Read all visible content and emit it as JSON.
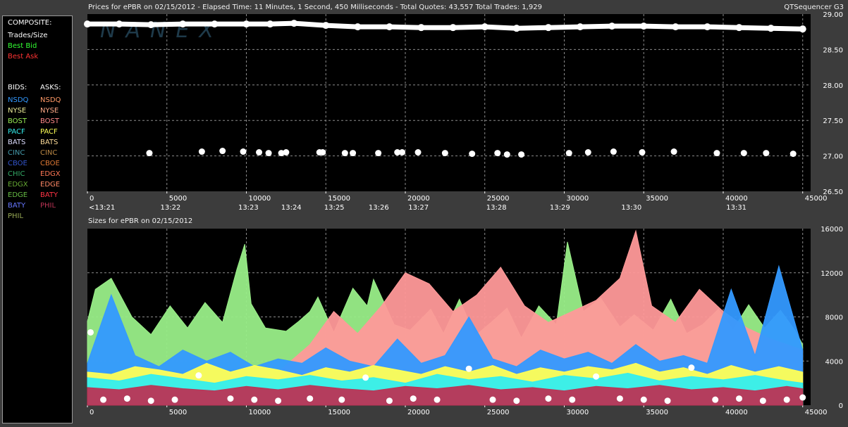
{
  "header": {
    "title": "Prices for  ePBR  on  02/15/2012  -  Elapsed Time: 11 Minutes, 1 Second, 450 Milliseconds  -  Total Quotes: 43,557  Total Trades: 1,929",
    "app_name": "QTSequencer G3"
  },
  "watermark": "NANEX",
  "legend": {
    "composite_label": "COMPOSITE:",
    "composite": [
      {
        "label": "Trades/Size",
        "color": "#ffffff"
      },
      {
        "label": "Best Bid",
        "color": "#33ff33"
      },
      {
        "label": "Best Ask",
        "color": "#ff3333"
      }
    ],
    "bids_label": "BIDS:",
    "asks_label": "ASKS:",
    "bids": [
      {
        "label": "NSDQ",
        "color": "#3399ff"
      },
      {
        "label": "NYSE",
        "color": "#eeee99"
      },
      {
        "label": "BOST",
        "color": "#99ee55"
      },
      {
        "label": "PACF",
        "color": "#33eeee"
      },
      {
        "label": "BATS",
        "color": "#ddddff"
      },
      {
        "label": "CINC",
        "color": "#4499aa"
      },
      {
        "label": "CBOE",
        "color": "#3355cc"
      },
      {
        "label": "CHIC",
        "color": "#33aa66"
      },
      {
        "label": "EDGX",
        "color": "#66aa33"
      },
      {
        "label": "EDGE",
        "color": "#66bb44"
      },
      {
        "label": "BATY",
        "color": "#6677ff"
      },
      {
        "label": "PHIL",
        "color": "#99aa55"
      }
    ],
    "asks": [
      {
        "label": "NSDQ",
        "color": "#ff9966"
      },
      {
        "label": "NYSE",
        "color": "#ffaa88"
      },
      {
        "label": "BOST",
        "color": "#ff8888"
      },
      {
        "label": "PACF",
        "color": "#ffff55"
      },
      {
        "label": "BATS",
        "color": "#ffdd99"
      },
      {
        "label": "CINC",
        "color": "#bb8844"
      },
      {
        "label": "CBOE",
        "color": "#dd7733"
      },
      {
        "label": "EDGX",
        "color": "#ff7755"
      },
      {
        "label": "EDGE",
        "color": "#ff8866"
      },
      {
        "label": "BATY",
        "color": "#ff3344"
      },
      {
        "label": "PHIL",
        "color": "#bb3355"
      }
    ]
  },
  "chart_data": [
    {
      "type": "scatter",
      "title": "Prices for  ePBR  on  02/15/2012",
      "x_ticks": [
        0,
        5000,
        10000,
        15000,
        20000,
        25000,
        30000,
        35000,
        40000,
        45000
      ],
      "time_ticks": [
        {
          "x": 0,
          "label": "<13:21"
        },
        {
          "x": 4500,
          "label": "13:22"
        },
        {
          "x": 9400,
          "label": "13:23"
        },
        {
          "x": 12100,
          "label": "13:24"
        },
        {
          "x": 14800,
          "label": "13:25"
        },
        {
          "x": 17600,
          "label": "13:26"
        },
        {
          "x": 20100,
          "label": "13:27"
        },
        {
          "x": 25000,
          "label": "13:28"
        },
        {
          "x": 29000,
          "label": "13:29"
        },
        {
          "x": 33500,
          "label": "13:30"
        },
        {
          "x": 40100,
          "label": "13:31"
        }
      ],
      "xlim": [
        0,
        45500
      ],
      "y_ticks": [
        29.0,
        28.5,
        28.0,
        27.5,
        27.0,
        26.5
      ],
      "ylim": [
        26.5,
        29.0
      ],
      "grid": true,
      "series": [
        {
          "name": "Trades/Size",
          "color": "#ffffff",
          "x": [
            3900,
            7200,
            8500,
            9800,
            10800,
            11400,
            12200,
            12500,
            14600,
            14800,
            16200,
            16700,
            18300,
            19500,
            19800,
            20800,
            22500,
            24200,
            25800,
            26400,
            27300,
            30300,
            31500,
            33100,
            34900,
            36900,
            39600,
            41300,
            42700,
            44400
          ],
          "y": [
            27.04,
            27.06,
            27.07,
            27.06,
            27.05,
            27.04,
            27.04,
            27.05,
            27.05,
            27.05,
            27.04,
            27.04,
            27.04,
            27.05,
            27.05,
            27.05,
            27.04,
            27.03,
            27.04,
            27.02,
            27.02,
            27.04,
            27.05,
            27.06,
            27.05,
            27.06,
            27.04,
            27.04,
            27.04,
            27.03
          ]
        },
        {
          "name": "Trades/Size",
          "color": "#ffffff",
          "x": [
            0,
            2000,
            4000,
            6000,
            8000,
            10000,
            11500,
            13000,
            15000,
            17000,
            19000,
            21000,
            23000,
            25000,
            27000,
            29000,
            31000,
            33000,
            35000,
            37000,
            39000,
            41000,
            43000,
            45000
          ],
          "y": [
            28.86,
            28.86,
            28.85,
            28.86,
            28.86,
            28.86,
            28.86,
            28.87,
            28.84,
            28.82,
            28.82,
            28.81,
            28.81,
            28.82,
            28.8,
            28.81,
            28.82,
            28.83,
            28.83,
            28.82,
            28.82,
            28.81,
            28.8,
            28.79
          ]
        }
      ]
    },
    {
      "type": "area",
      "title": "Sizes for  ePBR  on  02/15/2012",
      "x_ticks": [
        0,
        5000,
        10000,
        15000,
        20000,
        25000,
        30000,
        35000,
        40000,
        45000
      ],
      "xlim": [
        0,
        45500
      ],
      "y_ticks": [
        16000,
        12000,
        8000,
        4000,
        0
      ],
      "ylim": [
        0,
        16000
      ],
      "grid": true,
      "series": [
        {
          "name": "BOST",
          "color": "#99ee88",
          "x": [
            0,
            500,
            1500,
            2800,
            4000,
            5200,
            6300,
            7400,
            8500,
            9400,
            9900,
            10300,
            11200,
            12500,
            13300,
            14000,
            14500,
            15500,
            16700,
            17600,
            18000,
            19300,
            20300,
            21600,
            22400,
            23400,
            24400,
            25400,
            26400,
            27300,
            28400,
            29500,
            30200,
            31200,
            32300,
            33500,
            34400,
            35600,
            36700,
            37700,
            38700,
            39700,
            40600,
            41600,
            42600,
            43600,
            44500,
            45000
          ],
          "y": [
            7600,
            10500,
            11500,
            8000,
            6400,
            9000,
            7000,
            9300,
            7500,
            12300,
            14600,
            9200,
            7000,
            6700,
            7600,
            8500,
            9800,
            6600,
            10600,
            9000,
            11400,
            7300,
            6800,
            8700,
            6500,
            9600,
            6300,
            7500,
            8800,
            6100,
            9000,
            7300,
            14800,
            8500,
            9700,
            7100,
            8200,
            6800,
            9600,
            6500,
            7300,
            8700,
            6800,
            9100,
            7000,
            8600,
            6800,
            5500
          ]
        },
        {
          "name": "BOST",
          "color": "#ff9999",
          "x": [
            12000,
            14000,
            15500,
            17000,
            18500,
            20000,
            21500,
            23000,
            24500,
            26000,
            27500,
            29000,
            30500,
            32000,
            33500,
            34500,
            35500,
            37000,
            38500,
            40000,
            41500,
            43000,
            45000
          ],
          "y": [
            3000,
            5500,
            8500,
            6500,
            9000,
            12000,
            11000,
            8500,
            10000,
            12500,
            9000,
            7500,
            8500,
            9500,
            11500,
            15800,
            9000,
            7500,
            10500,
            8500,
            7000,
            6000,
            5000
          ]
        },
        {
          "name": "NSDQ",
          "color": "#3399ff",
          "x": [
            0,
            1500,
            3000,
            4500,
            6000,
            7500,
            9000,
            10500,
            12000,
            13500,
            15000,
            16500,
            18000,
            19500,
            21000,
            22500,
            24000,
            25500,
            27000,
            28500,
            30000,
            31500,
            33000,
            34500,
            36000,
            37500,
            39000,
            40500,
            42000,
            43500,
            45000
          ],
          "y": [
            3800,
            10000,
            4500,
            3500,
            5000,
            4000,
            4800,
            3500,
            4200,
            3800,
            5200,
            4000,
            3500,
            6000,
            3800,
            4500,
            8000,
            4200,
            3500,
            5000,
            4200,
            4800,
            3800,
            5500,
            4000,
            4500,
            3800,
            10500,
            4500,
            12600,
            5000
          ]
        },
        {
          "name": "PACF",
          "color": "#ffff55",
          "x": [
            0,
            1500,
            3000,
            4500,
            6000,
            7500,
            9000,
            10500,
            12000,
            13500,
            15000,
            16500,
            18000,
            19500,
            21000,
            22500,
            24000,
            25500,
            27000,
            28500,
            30000,
            31500,
            33000,
            34500,
            36000,
            37500,
            39000,
            40500,
            42000,
            43500,
            45000
          ],
          "y": [
            3000,
            2800,
            3500,
            3200,
            2800,
            3800,
            3000,
            3600,
            3200,
            2700,
            3400,
            3000,
            3600,
            3200,
            2800,
            3500,
            3000,
            3600,
            2800,
            3400,
            3000,
            3500,
            3200,
            3800,
            3000,
            3400,
            2800,
            3600,
            3000,
            3500,
            3000
          ]
        },
        {
          "name": "PACF",
          "color": "#33eeee",
          "x": [
            0,
            2000,
            4000,
            6000,
            8000,
            10000,
            12000,
            14000,
            16000,
            18000,
            20000,
            22000,
            24000,
            26000,
            28000,
            30000,
            32000,
            34000,
            36000,
            38000,
            40000,
            42000,
            44000,
            45000
          ],
          "y": [
            2500,
            2200,
            2800,
            2400,
            2000,
            2600,
            2300,
            2700,
            2200,
            2500,
            2000,
            2800,
            2300,
            2600,
            2100,
            2700,
            2400,
            2900,
            2200,
            2600,
            2300,
            2700,
            2200,
            2000
          ]
        },
        {
          "name": "BATY",
          "color": "#bb3355",
          "x": [
            0,
            2000,
            4000,
            6000,
            8000,
            10000,
            12000,
            14000,
            16000,
            18000,
            20000,
            22000,
            24000,
            26000,
            28000,
            30000,
            32000,
            34000,
            36000,
            38000,
            40000,
            42000,
            44000,
            45000
          ],
          "y": [
            1600,
            1400,
            1800,
            1500,
            1300,
            1700,
            1400,
            1800,
            1500,
            1300,
            1700,
            1500,
            1800,
            1400,
            1600,
            1300,
            1700,
            1500,
            1800,
            1400,
            1600,
            1300,
            1700,
            1500
          ]
        },
        {
          "name": "Trades/Size",
          "color": "#ffffff",
          "x": [
            200,
            1000,
            2500,
            4000,
            5500,
            7000,
            9000,
            10500,
            12000,
            14000,
            16000,
            17500,
            19000,
            20500,
            22000,
            24000,
            25500,
            27000,
            29000,
            30500,
            32000,
            33500,
            35000,
            36500,
            38000,
            39500,
            41000,
            42500,
            44000,
            45000
          ],
          "y": [
            6600,
            500,
            600,
            400,
            500,
            2700,
            600,
            500,
            400,
            600,
            500,
            2500,
            400,
            600,
            500,
            3300,
            500,
            400,
            600,
            500,
            2600,
            600,
            500,
            400,
            3400,
            500,
            600,
            400,
            500,
            700
          ]
        }
      ]
    }
  ]
}
